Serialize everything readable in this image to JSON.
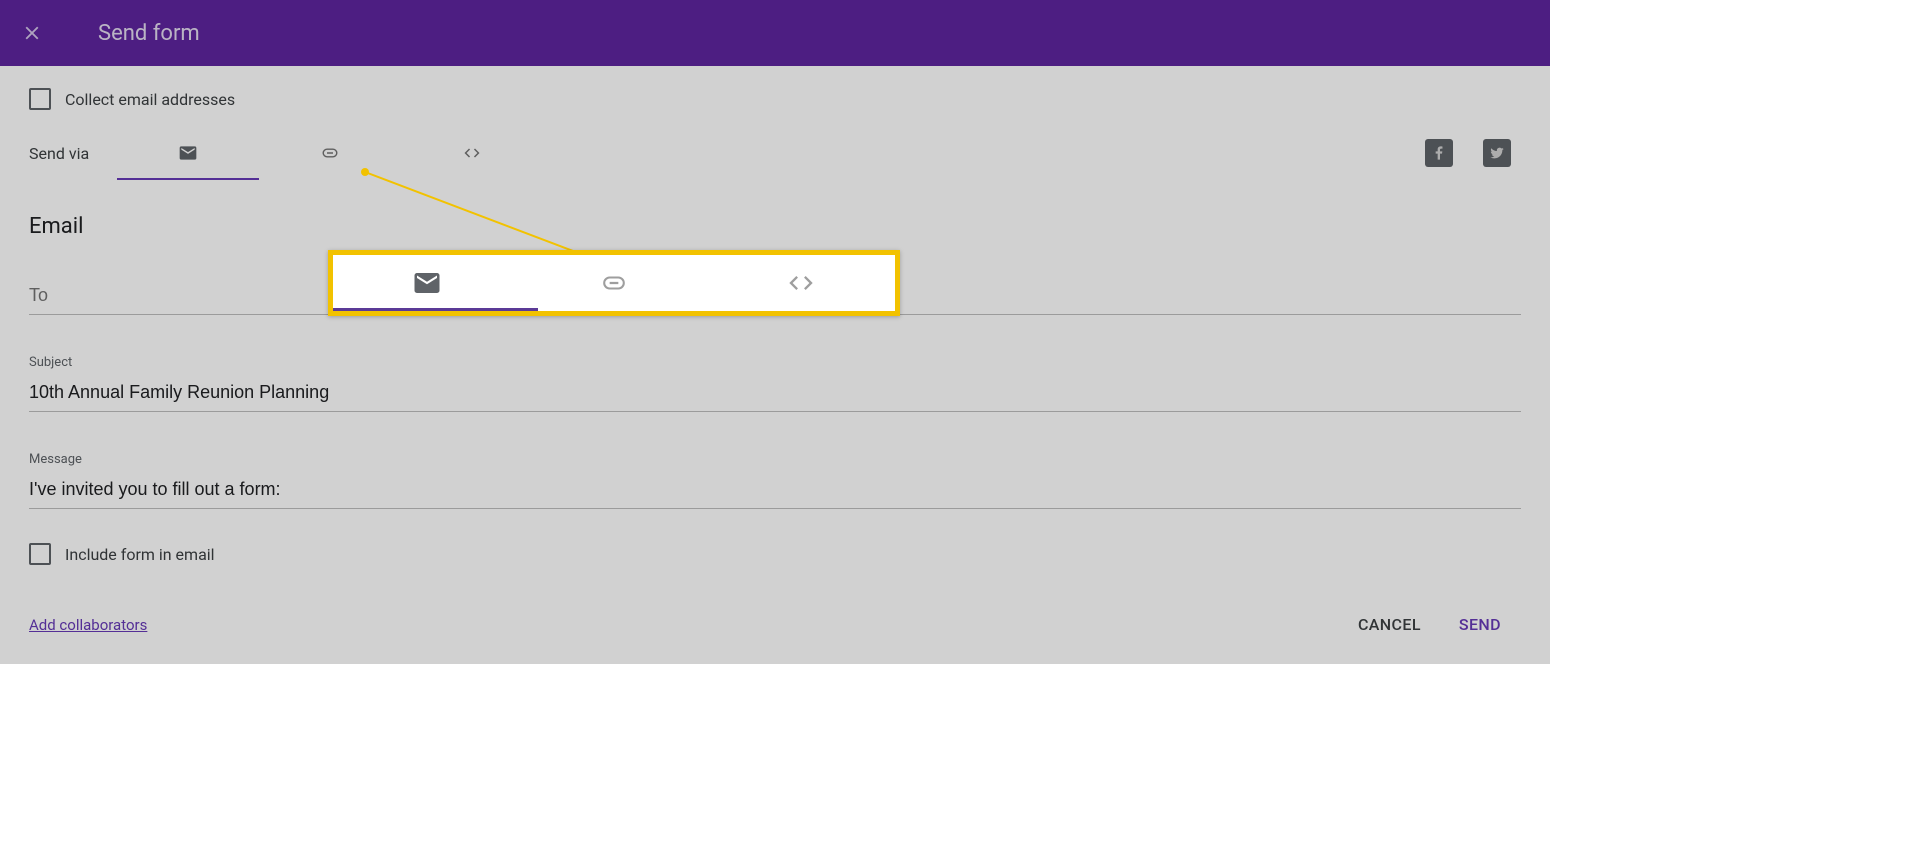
{
  "header": {
    "title": "Send form"
  },
  "options": {
    "collect_email_label": "Collect email addresses",
    "send_via_label": "Send via",
    "include_form_label": "Include form in email"
  },
  "section": {
    "email_title": "Email"
  },
  "fields": {
    "to_label": "To",
    "to_value": "",
    "subject_label": "Subject",
    "subject_value": "10th Annual Family Reunion Planning",
    "message_label": "Message",
    "message_value": "I've invited you to fill out a form:"
  },
  "footer": {
    "add_collaborators": "Add collaborators",
    "cancel": "CANCEL",
    "send": "SEND"
  },
  "tabs": {
    "email_icon": "email-icon",
    "link_icon": "link-icon",
    "embed_icon": "embed-icon"
  },
  "social": {
    "facebook": "facebook-icon",
    "twitter": "twitter-icon"
  }
}
